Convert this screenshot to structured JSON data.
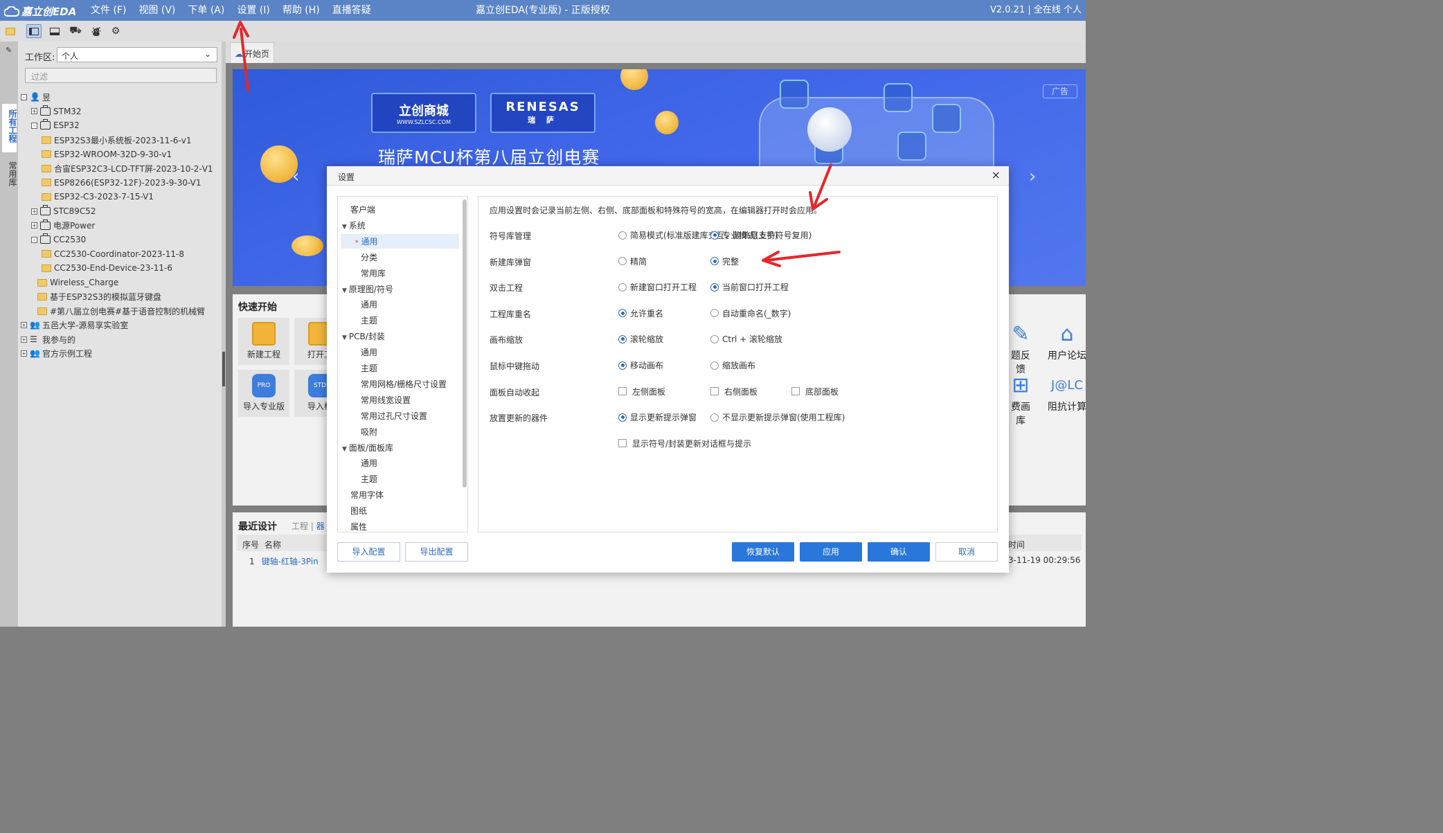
{
  "titlebar": {
    "logo": "嘉立创EDA",
    "menus": [
      "文件 (F)",
      "视图 (V)",
      "下单 (A)",
      "设置 (I)",
      "帮助 (H)",
      "直播答疑"
    ],
    "title": "嘉立创EDA(专业版) - 正版授权",
    "version": "V2.0.21 | 全在线  个人"
  },
  "toolbar": {
    "icons": [
      "folder-icon",
      "left-panel-icon",
      "bottom-panel-icon",
      "cart-icon",
      "order-icon",
      "gear-icon"
    ]
  },
  "leftstrip": {
    "tab_all": "所有工程",
    "tab_common": "常用库"
  },
  "leftpanel": {
    "workspace_label": "工作区:",
    "workspace_value": "个人",
    "filter_placeholder": "过滤",
    "tree": [
      {
        "label": "昱",
        "depth": 0,
        "exp": "-",
        "icon": "user"
      },
      {
        "label": "STM32",
        "depth": 1,
        "exp": "+",
        "icon": "case"
      },
      {
        "label": "ESP32",
        "depth": 1,
        "exp": "-",
        "icon": "case"
      },
      {
        "label": "ESP32S3最小系统板-2023-11-6-v1",
        "depth": 2,
        "exp": "",
        "icon": "folder"
      },
      {
        "label": "ESP32-WROOM-32D-9-30-v1",
        "depth": 2,
        "exp": "",
        "icon": "folder"
      },
      {
        "label": "合宙ESP32C3-LCD-TFT屏-2023-10-2-V1",
        "depth": 2,
        "exp": "",
        "icon": "folder"
      },
      {
        "label": "ESP8266(ESP32-12F)-2023-9-30-V1",
        "depth": 2,
        "exp": "",
        "icon": "folder"
      },
      {
        "label": "ESP32-C3-2023-7-15-V1",
        "depth": 2,
        "exp": "",
        "icon": "folder"
      },
      {
        "label": "STC89C52",
        "depth": 1,
        "exp": "+",
        "icon": "case"
      },
      {
        "label": "电源Power",
        "depth": 1,
        "exp": "+",
        "icon": "case"
      },
      {
        "label": "CC2530",
        "depth": 1,
        "exp": "-",
        "icon": "case"
      },
      {
        "label": "CC2530-Coordinator-2023-11-8",
        "depth": 2,
        "exp": "",
        "icon": "folder"
      },
      {
        "label": "CC2530-End-Device-23-11-6",
        "depth": 2,
        "exp": "",
        "icon": "folder"
      },
      {
        "label": "Wireless_Charge",
        "depth": 1.6,
        "exp": "",
        "icon": "folder"
      },
      {
        "label": "基于ESP32S3的模拟蓝牙键盘",
        "depth": 1.6,
        "exp": "",
        "icon": "folder"
      },
      {
        "label": "#第八届立创电赛#基于语音控制的机械臂",
        "depth": 1.6,
        "exp": "",
        "icon": "folder"
      },
      {
        "label": "五邑大学-源易享实验室",
        "depth": 0,
        "exp": "+",
        "icon": "group"
      },
      {
        "label": "我参与的",
        "depth": 0,
        "exp": "+",
        "icon": "list"
      },
      {
        "label": "官方示例工程",
        "depth": 0,
        "exp": "+",
        "icon": "group"
      }
    ]
  },
  "tabs": {
    "home": "开始页"
  },
  "banner": {
    "lcsc": "立创商城",
    "lcsc_url": "WWW.SZLCSC.COM",
    "renesas": "RENESAS",
    "renesas_cn": "瑞 萨",
    "title": "瑞萨MCU杯第八届立创电赛",
    "ad": "广告"
  },
  "quick": {
    "title": "快速开始",
    "new_project": "新建工程",
    "open_project": "打开工",
    "import_pro": "导入专业版",
    "import_std": "导入标",
    "feedback": "题反馈",
    "forum": "用户论坛",
    "library": "费画库",
    "impedance": "阻抗计算"
  },
  "recent": {
    "title": "最近设计",
    "tab_project": "工程",
    "tab_device": "器",
    "col_no": "序号",
    "col_name": "名称",
    "col_time": "时间",
    "row_no": "1",
    "row_name": "键轴-红轴-3Pin",
    "row_time": "3-11-19 00:29:56"
  },
  "dialog": {
    "title": "设置",
    "close": "×",
    "intro": "应用设置时会记录当前左侧、右侧、底部面板和特殊符号的宽高，在编辑器打开时会应用。",
    "nav": [
      {
        "label": "客户端",
        "indent": 0,
        "tri": ""
      },
      {
        "label": "系统",
        "indent": 0,
        "tri": "▼"
      },
      {
        "label": "通用",
        "indent": 2,
        "tri": "",
        "sel": true
      },
      {
        "label": "分类",
        "indent": 2,
        "tri": ""
      },
      {
        "label": "常用库",
        "indent": 2,
        "tri": ""
      },
      {
        "label": "原理图/符号",
        "indent": 0,
        "tri": "▼"
      },
      {
        "label": "通用",
        "indent": 2,
        "tri": ""
      },
      {
        "label": "主题",
        "indent": 2,
        "tri": ""
      },
      {
        "label": "PCB/封装",
        "indent": 0,
        "tri": "▼"
      },
      {
        "label": "通用",
        "indent": 2,
        "tri": ""
      },
      {
        "label": "主题",
        "indent": 2,
        "tri": ""
      },
      {
        "label": "常用网格/栅格尺寸设置",
        "indent": 2,
        "tri": ""
      },
      {
        "label": "常用线宽设置",
        "indent": 2,
        "tri": ""
      },
      {
        "label": "常用过孔尺寸设置",
        "indent": 2,
        "tri": ""
      },
      {
        "label": "吸附",
        "indent": 2,
        "tri": ""
      },
      {
        "label": "面板/面板库",
        "indent": 0,
        "tri": "▼"
      },
      {
        "label": "通用",
        "indent": 2,
        "tri": ""
      },
      {
        "label": "主题",
        "indent": 2,
        "tri": ""
      },
      {
        "label": "常用字体",
        "indent": 0,
        "tri": ""
      },
      {
        "label": "图纸",
        "indent": 0,
        "tri": ""
      },
      {
        "label": "属性",
        "indent": 0,
        "tri": ""
      }
    ],
    "settings": [
      {
        "label": "符号库管理",
        "type": "radio",
        "options": [
          {
            "text": "简易模式(标准版建库交互，简单易上手)",
            "on": false
          },
          {
            "text": "专业模式(支持符号复用)",
            "on": true
          }
        ]
      },
      {
        "label": "新建库弹窗",
        "type": "radio",
        "options": [
          {
            "text": "精简",
            "on": false
          },
          {
            "text": "完整",
            "on": true
          }
        ]
      },
      {
        "label": "双击工程",
        "type": "radio",
        "options": [
          {
            "text": "新建窗口打开工程",
            "on": false
          },
          {
            "text": "当前窗口打开工程",
            "on": true
          }
        ]
      },
      {
        "label": "工程库重名",
        "type": "radio",
        "options": [
          {
            "text": "允许重名",
            "on": true
          },
          {
            "text": "自动重命名(_数字)",
            "on": false
          }
        ]
      },
      {
        "label": "画布缩放",
        "type": "radio",
        "options": [
          {
            "text": "滚轮缩放",
            "on": true
          },
          {
            "text": "Ctrl + 滚轮缩放",
            "on": false
          }
        ]
      },
      {
        "label": "鼠标中键拖动",
        "type": "radio",
        "options": [
          {
            "text": "移动画布",
            "on": true
          },
          {
            "text": "缩放画布",
            "on": false
          }
        ]
      },
      {
        "label": "面板自动收起",
        "type": "checkbox",
        "options": [
          {
            "text": "左侧面板",
            "on": false
          },
          {
            "text": "右侧面板",
            "on": false
          },
          {
            "text": "底部面板",
            "on": false
          }
        ]
      },
      {
        "label": "放置更新的器件",
        "type": "radio",
        "options": [
          {
            "text": "显示更新提示弹窗",
            "on": true
          },
          {
            "text": "不显示更新提示弹窗(使用工程库)",
            "on": false
          }
        ]
      },
      {
        "label": "",
        "type": "checkbox",
        "options": [
          {
            "text": "显示符号/封装更新对话框与提示",
            "on": false
          }
        ]
      }
    ],
    "buttons": {
      "import": "导入配置",
      "export": "导出配置",
      "reset": "恢复默认",
      "apply": "应用",
      "confirm": "确认",
      "cancel": "取消"
    }
  }
}
